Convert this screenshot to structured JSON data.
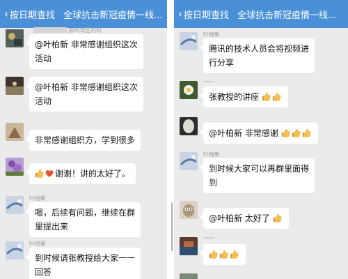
{
  "colors": {
    "nav_bg": "#4a90d9",
    "chat_bg": "#ebebeb",
    "bubble_bg": "#ffffff",
    "sender_text": "#9a9a9a"
  },
  "left": {
    "nav": {
      "back_label": "按日期查找",
      "title": "全球抗击新冠疫情一线..."
    },
    "messages": [
      {
        "sender": "加州湾区内科",
        "text_lines": [
          "@叶柏新 非常感谢组织这次",
          "活动"
        ]
      },
      {
        "sender": "",
        "text_lines": [
          "@叶柏新 非常感谢组织这次",
          "活动"
        ]
      },
      {
        "sender": "",
        "text_lines": [
          "非常感谢组织方，学到很多"
        ]
      },
      {
        "sender": "",
        "text": "谢谢！讲的太好了。",
        "leading_icons": [
          "thumbs-up-icon",
          "heart-icon"
        ]
      },
      {
        "sender": "叶柏新",
        "text_lines": [
          "嗯，后续有问题，继续在群",
          "里提出来"
        ]
      },
      {
        "sender": "叶柏新",
        "text_lines": [
          "到时候请张教授给大家一一",
          "回答"
        ]
      }
    ]
  },
  "right": {
    "nav": {
      "back_label": "按日期查找",
      "title": "全球抗击新冠疫情一线..."
    },
    "messages": [
      {
        "sender": "叶柏新",
        "text_lines": [
          "腾讯的技术人员会将视频进",
          "行分享"
        ]
      },
      {
        "sender": "",
        "text": "张教授的讲座",
        "trailing_icons": [
          "thumbs-up-icon",
          "thumbs-up-icon"
        ]
      },
      {
        "sender": "",
        "text": "@叶柏新  非常感谢",
        "trailing_icons": [
          "thumbs-up-icon",
          "thumbs-up-icon",
          "thumbs-up-icon"
        ]
      },
      {
        "sender": "叶柏新",
        "text_lines": [
          "到时候大家可以再群里面得",
          "到"
        ]
      },
      {
        "sender": "",
        "text": "@叶柏新 太好了",
        "trailing_icons": [
          "thumbs-up-icon"
        ]
      },
      {
        "sender": "",
        "text": "",
        "trailing_icons": [
          "thumbs-up-icon",
          "thumbs-up-icon",
          "thumbs-up-icon"
        ]
      }
    ]
  }
}
